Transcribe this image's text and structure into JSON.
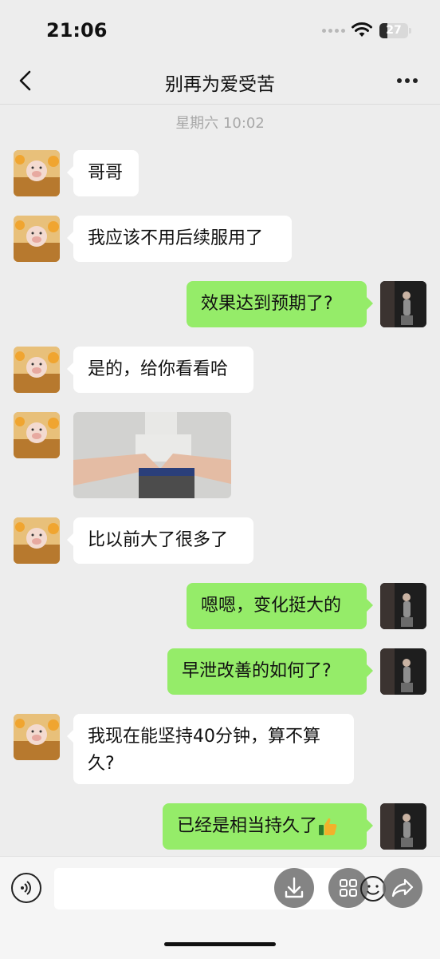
{
  "status": {
    "time": "21:06",
    "battery": "27",
    "battery_level": 0.27
  },
  "header": {
    "title": "别再为爱受苦",
    "back_icon": "chevron-left-icon",
    "more_icon": "more-dots-icon"
  },
  "timestamp": "星期六 10:02",
  "messages": [
    {
      "side": "in",
      "text": "哥哥"
    },
    {
      "side": "in",
      "text": "我应该不用后续服用了"
    },
    {
      "side": "out",
      "text": "效果达到预期了?"
    },
    {
      "side": "in",
      "text": "是的，给你看看哈"
    },
    {
      "side": "in",
      "type": "image"
    },
    {
      "side": "in",
      "text": "比以前大了很多了"
    },
    {
      "side": "out",
      "text": "嗯嗯，变化挺大的"
    },
    {
      "side": "out",
      "text": "早泄改善的如何了?"
    },
    {
      "side": "in",
      "text": "我现在能坚持40分钟，算不算久?"
    },
    {
      "side": "out",
      "text": "已经是相当持久了",
      "emoji": "thumbs-up-icon"
    }
  ],
  "colors": {
    "background": "#ededed",
    "bubble_out": "#95ec69",
    "bubble_in": "#ffffff"
  }
}
